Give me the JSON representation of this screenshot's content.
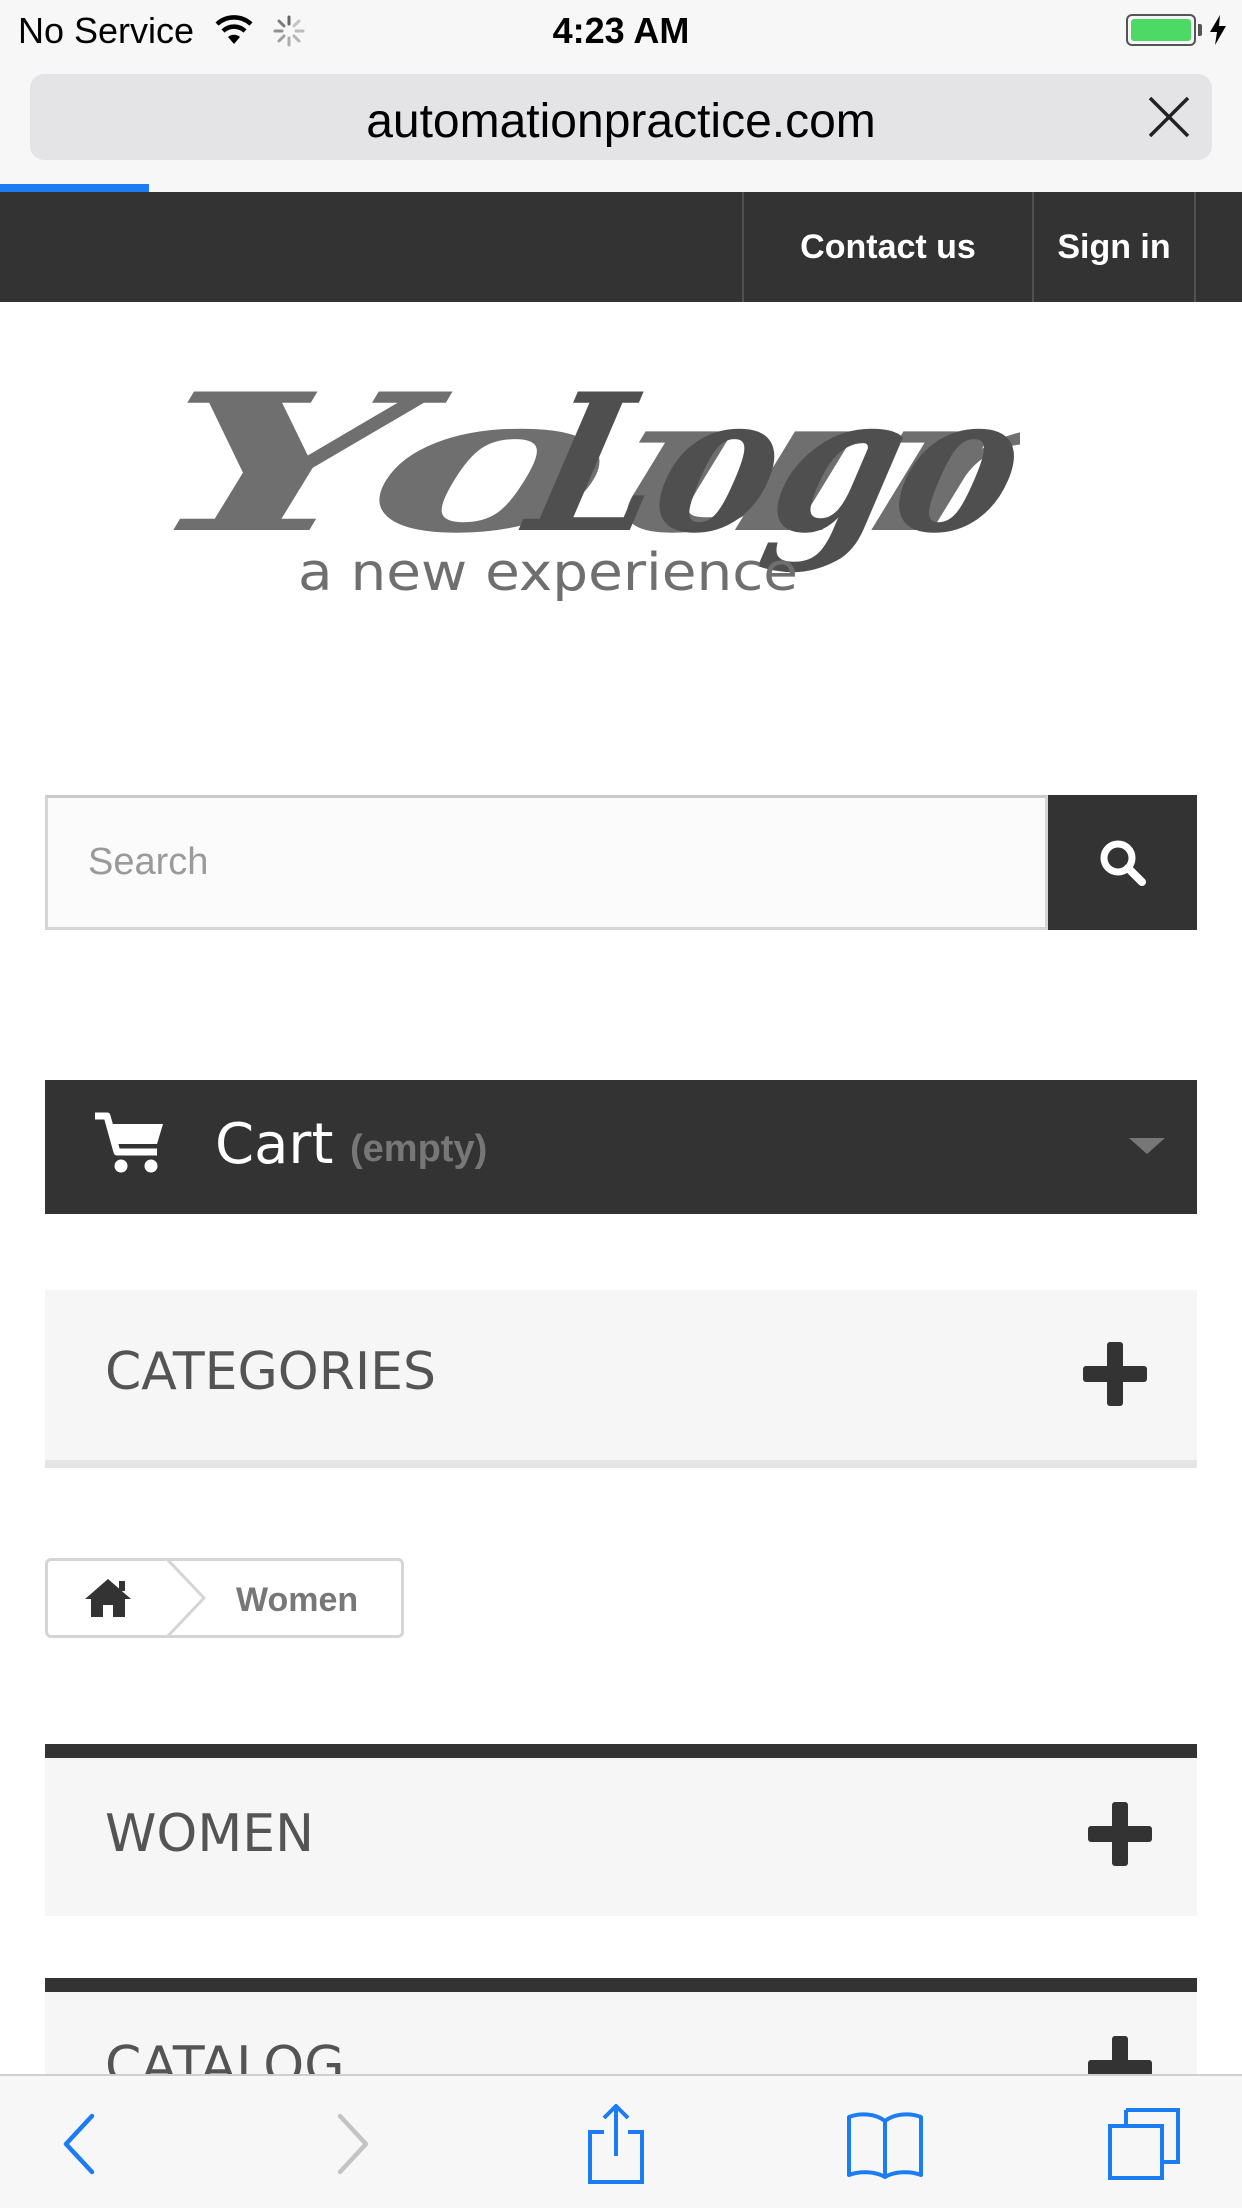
{
  "status_bar": {
    "carrier": "No Service",
    "time": "4:23 AM",
    "battery_color": "#4cd964"
  },
  "browser": {
    "url": "automationpractice.com",
    "progress_fraction": 0.12,
    "accent_color": "#1c7cf4"
  },
  "top_nav": {
    "contact_label": "Contact us",
    "signin_label": "Sign in"
  },
  "logo": {
    "wordmark": "YourLogo",
    "tagline": "a new experience"
  },
  "search": {
    "placeholder": "Search",
    "value": ""
  },
  "cart": {
    "label": "Cart",
    "status": "(empty)"
  },
  "blocks": {
    "categories_title": "CATEGORIES",
    "women_title": "WOMEN",
    "catalog_title": "CATALOG"
  },
  "breadcrumb": {
    "home_icon": "home-icon",
    "current": "Women"
  },
  "colors": {
    "dark": "#333333",
    "block_bg": "#f6f6f6",
    "title_text": "#555454"
  },
  "icons": {
    "search": "search-icon",
    "cart": "cart-icon",
    "expand": "plus-icon",
    "close": "close-icon",
    "back": "back-icon",
    "forward": "forward-icon",
    "share": "share-icon",
    "bookmarks": "bookmarks-icon",
    "tabs": "tabs-icon"
  }
}
